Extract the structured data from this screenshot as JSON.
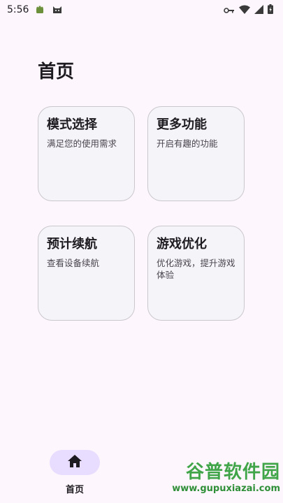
{
  "status_bar": {
    "time": "5:56",
    "left_icons": [
      "android-icon",
      "cat-icon"
    ],
    "right_icons": [
      "key-icon",
      "wifi-icon",
      "signal-icon",
      "battery-icon"
    ]
  },
  "page": {
    "title": "首页"
  },
  "cards": [
    {
      "title": "模式选择",
      "desc": "满足您的使用需求"
    },
    {
      "title": "更多功能",
      "desc": "开启有趣的功能"
    },
    {
      "title": "预计续航",
      "desc": "查看设备续航"
    },
    {
      "title": "游戏优化",
      "desc": "优化游戏，提升游戏体验"
    }
  ],
  "bottom_nav": {
    "items": [
      {
        "label": "首页",
        "icon": "home-icon",
        "selected": true
      }
    ]
  },
  "watermark": {
    "title": "谷普软件园",
    "url": "www.gupuxiazai.com"
  },
  "colors": {
    "background": "#FDF6FD",
    "card_background": "#F5F4F8",
    "card_border": "#C9C7CC",
    "nav_indicator": "#E9DDFF",
    "watermark_green": "#3FA548"
  }
}
